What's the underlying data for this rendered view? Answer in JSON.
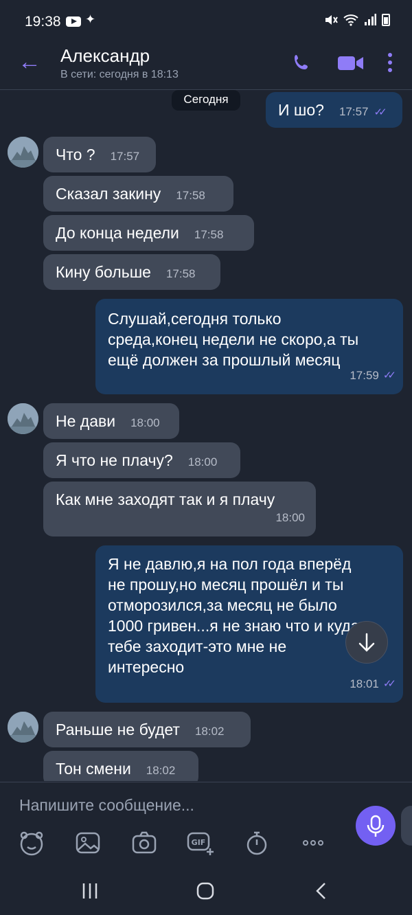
{
  "status_bar": {
    "time": "19:38",
    "icons": [
      "youtube-icon",
      "magic-wand-icon",
      "mute-icon",
      "wifi-icon",
      "signal-icon",
      "battery-icon"
    ]
  },
  "header": {
    "name": "Александр",
    "status": "В сети: сегодня в 18:13",
    "accent": "#8f7cf7"
  },
  "chat": {
    "date_label": "Сегодня",
    "scroll_icon": "arrow-down-icon",
    "messages": [
      {
        "dir": "out",
        "text": "И шо?",
        "time": "17:57",
        "read": true
      },
      {
        "dir": "in",
        "text": "Что ?",
        "time": "17:57"
      },
      {
        "dir": "in",
        "text": "Сказал закину",
        "time": "17:58"
      },
      {
        "dir": "in",
        "text": "До конца недели",
        "time": "17:58"
      },
      {
        "dir": "in",
        "text": "Кину больше",
        "time": "17:58"
      },
      {
        "dir": "out",
        "lines": [
          "Слушай,сегодня только",
          "среда,конец недели не скоро,а ты",
          "ещё должен за прошлый месяц"
        ],
        "time": "17:59",
        "read": true
      },
      {
        "dir": "in",
        "text": "Не дави",
        "time": "18:00"
      },
      {
        "dir": "in",
        "text": "Я что не плачу?",
        "time": "18:00"
      },
      {
        "dir": "in",
        "text": "Как мне заходят так и я плачу",
        "time": "18:00"
      },
      {
        "dir": "out",
        "lines": [
          "Я не давлю,я на пол года вперёд",
          "не прошу,но месяц прошёл и ты",
          "отморозился,за месяц не было",
          "1000 гривен...я не знаю что и куда",
          "тебе заходит-это мне не",
          "интересно"
        ],
        "time": "18:01",
        "read": true
      },
      {
        "dir": "in",
        "text": "Раньше не будет",
        "time": "18:02"
      },
      {
        "dir": "in",
        "text": "Тон смени",
        "time": "18:02"
      }
    ]
  },
  "composer": {
    "placeholder": "Напишите сообщение...",
    "tools": [
      "sticker-icon",
      "gallery-icon",
      "camera-icon",
      "gif-icon",
      "timer-icon",
      "more-options-icon"
    ],
    "send_icon": "microphone-icon",
    "mic_color": "#7360f2"
  },
  "nav_bar": {
    "buttons": [
      "recent-apps-icon",
      "home-icon",
      "back-icon"
    ]
  }
}
